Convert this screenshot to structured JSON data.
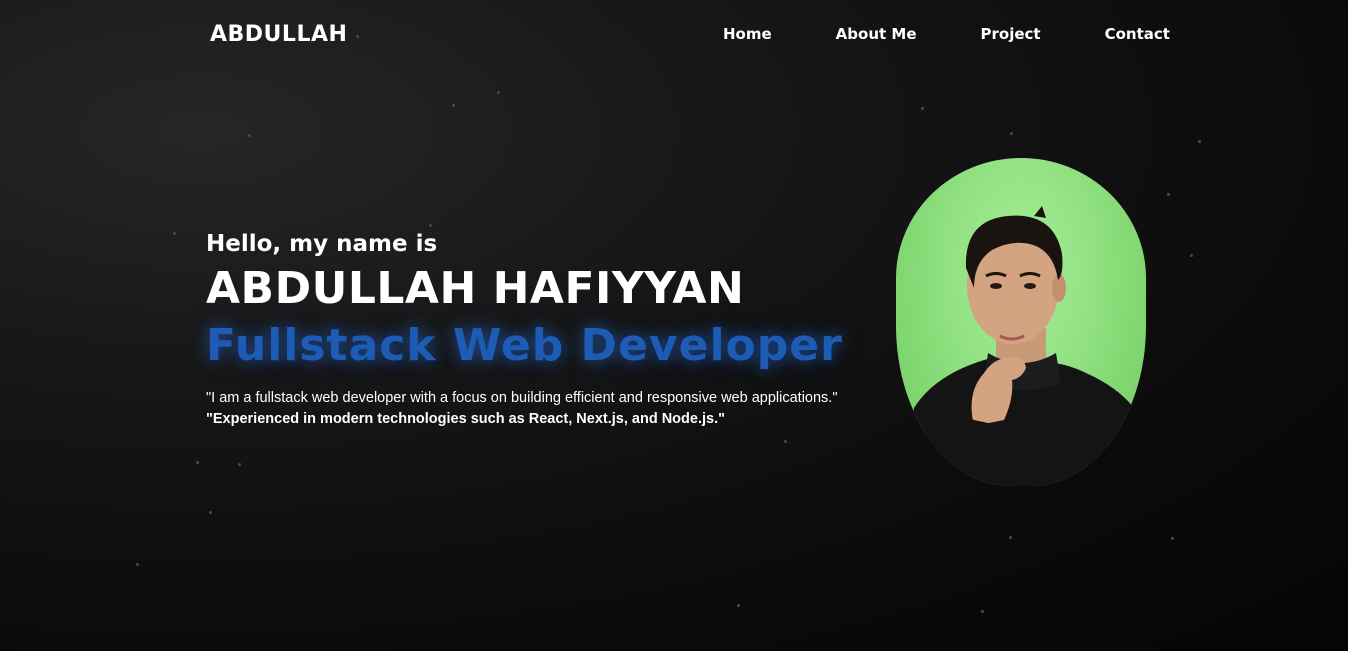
{
  "header": {
    "logo": "ABDULLAH",
    "nav": [
      "Home",
      "About Me",
      "Project",
      "Contact"
    ]
  },
  "hero": {
    "greeting": "Hello, my name is",
    "name": "ABDULLAH HAFIYYAN",
    "role": "Fullstack Web Developer",
    "quote_line1": "\"I am a fullstack web developer with a focus on building efficient and responsive web applications.\"",
    "quote_line2": "\"Experienced in modern technologies such as React, Next.js, and Node.js.\""
  },
  "colors": {
    "background": "#0b0b0b",
    "accent": "#1d5bb5",
    "photo_bg": "#8fe07e"
  }
}
